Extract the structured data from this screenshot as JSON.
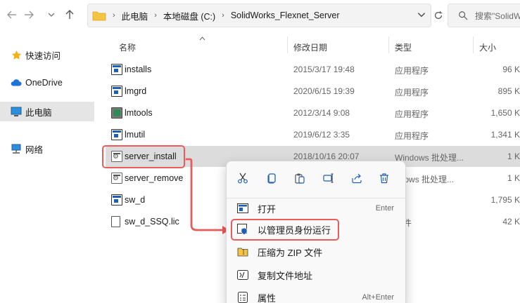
{
  "toolbar": {
    "back_icon": "arrow-left-icon",
    "forward_icon": "arrow-right-icon",
    "up_icon": "arrow-up-icon"
  },
  "address": {
    "crumbs": [
      "此电脑",
      "本地磁盘 (C:)",
      "SolidWorks_Flexnet_Server"
    ]
  },
  "search": {
    "placeholder": "搜索\"SolidWorks_Flexnet_Server\""
  },
  "sidebar": {
    "items": [
      {
        "label": "快速访问",
        "icon": "star-icon"
      },
      {
        "label": "OneDrive",
        "icon": "cloud-icon"
      },
      {
        "label": "此电脑",
        "icon": "computer-icon"
      },
      {
        "label": "网络",
        "icon": "network-icon"
      }
    ]
  },
  "columns": {
    "name": "名称",
    "date": "修改日期",
    "type": "类型",
    "size": "大小"
  },
  "files": [
    {
      "name": "installs",
      "date": "2015/3/17 19:48",
      "type": "应用程序",
      "size": "96 K",
      "icon": "exe"
    },
    {
      "name": "lmgrd",
      "date": "2020/6/15 19:39",
      "type": "应用程序",
      "size": "895 K",
      "icon": "exe"
    },
    {
      "name": "lmtools",
      "date": "2012/3/14 9:08",
      "type": "应用程序",
      "size": "1,650 K",
      "icon": "app"
    },
    {
      "name": "lmutil",
      "date": "2019/6/12 3:35",
      "type": "应用程序",
      "size": "1,341 K",
      "icon": "exe"
    },
    {
      "name": "server_install",
      "date": "2018/10/16 20:07",
      "type": "Windows 批处理...",
      "size": "1 K",
      "icon": "bat"
    },
    {
      "name": "server_remove",
      "date": "",
      "type": "ndows 批处理...",
      "size": "1 K",
      "icon": "bat"
    },
    {
      "name": "sw_d",
      "date": "",
      "type": "",
      "size": "1,795 K",
      "icon": "exe"
    },
    {
      "name": "sw_d_SSQ.lic",
      "date": "",
      "type": "文件",
      "size": "42 K",
      "icon": "doc"
    }
  ],
  "context_menu": {
    "toolbar_icons": [
      "cut-icon",
      "copy-icon",
      "paste-icon",
      "rename-icon",
      "share-icon",
      "delete-icon"
    ],
    "items": [
      {
        "label": "打开",
        "shortcut": "Enter",
        "icon": "open-icon"
      },
      {
        "label": "以管理员身份运行",
        "shortcut": "",
        "icon": "shield-icon"
      },
      {
        "label": "压缩为 ZIP 文件",
        "shortcut": "",
        "icon": "zip-icon"
      },
      {
        "label": "复制文件地址",
        "shortcut": "",
        "icon": "copy-path-icon"
      },
      {
        "label": "属性",
        "shortcut": "Alt+Enter",
        "icon": "properties-icon"
      }
    ]
  },
  "colors": {
    "highlight": "#e85c5c",
    "accent": "#1e5fb4"
  }
}
